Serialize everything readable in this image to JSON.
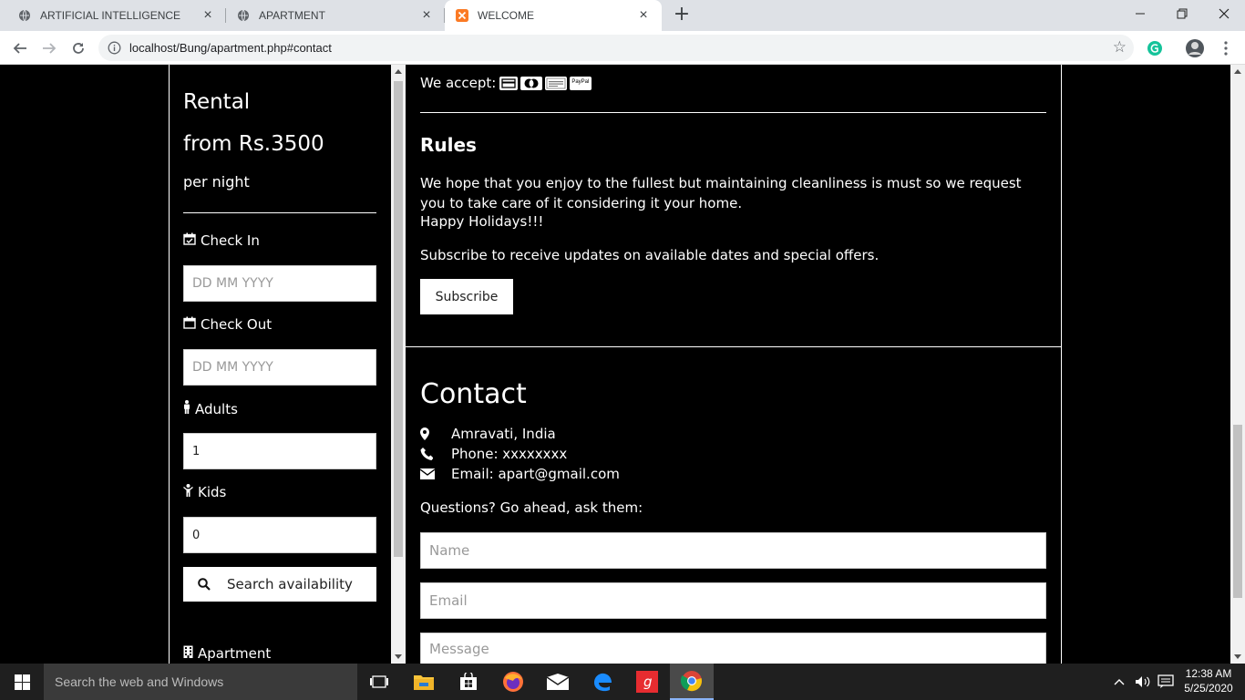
{
  "browser": {
    "tabs": [
      {
        "title": "ARTIFICIAL INTELLIGENCE",
        "close": "×"
      },
      {
        "title": "APARTMENT",
        "close": "×"
      },
      {
        "title": "WELCOME",
        "close": "×"
      }
    ],
    "new_tab": "+",
    "url": "localhost/Bung/apartment.php#contact"
  },
  "sidebar": {
    "heading": "Rental",
    "price": "from Rs.3500",
    "per": "per night",
    "check_in_label": "Check In",
    "check_in_placeholder": "DD MM YYYY",
    "check_out_label": "Check Out",
    "check_out_placeholder": "DD MM YYYY",
    "adults_label": "Adults",
    "adults_value": "1",
    "kids_label": "Kids",
    "kids_value": "0",
    "search_button": "Search availability",
    "apartment_link": "Apartment"
  },
  "main": {
    "we_accept": "We accept:",
    "payment_cards": [
      "card-icon",
      "mastercard-icon",
      "amex-icon",
      "paypal-icon"
    ],
    "paypal_text": "PayPal",
    "rules_title": "Rules",
    "rules_text": "We hope that you enjoy to the fullest but maintaining cleanliness is must so we request you to take care of it considering it your home.",
    "rules_text2": "Happy Holidays!!!",
    "subscribe_text": "Subscribe to receive updates on available dates and special offers.",
    "subscribe_button": "Subscribe",
    "contact_title": "Contact",
    "address": "Amravati, India",
    "phone": "Phone: xxxxxxxx",
    "email": "Email: apart@gmail.com",
    "questions": "Questions? Go ahead, ask them:",
    "name_placeholder": "Name",
    "email_placeholder": "Email",
    "message_placeholder": "Message"
  },
  "taskbar": {
    "search_placeholder": "Search the web and Windows",
    "time": "12:38 AM",
    "date": "5/25/2020"
  }
}
